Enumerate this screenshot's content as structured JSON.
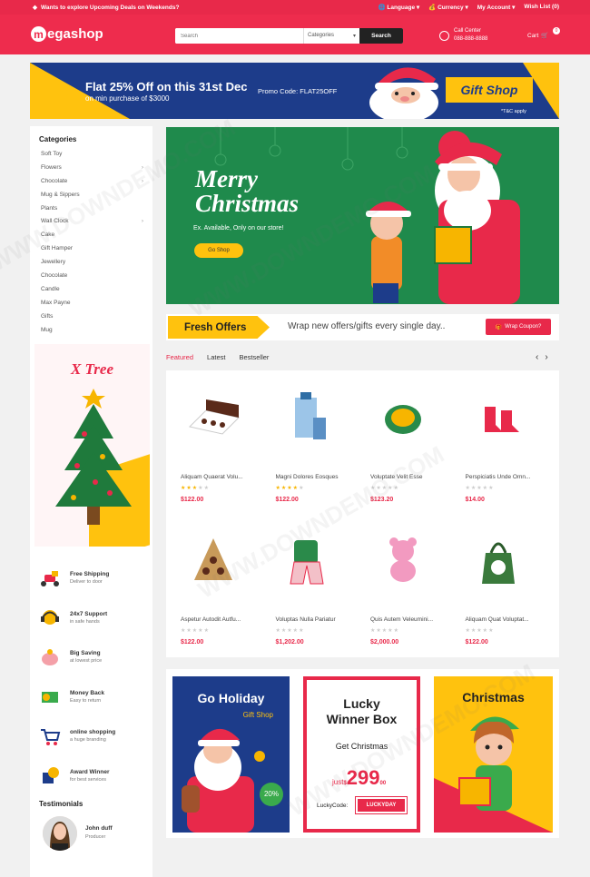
{
  "topbar": {
    "promo": "Wants to explore Upcoming Deals on Weekends?",
    "language": "Language",
    "currency": "Currency",
    "account": "My Account",
    "wishlist": "Wish List (0)"
  },
  "header": {
    "logo": "egashop",
    "logo_initial": "m",
    "search_placeholder": "Search",
    "categories_label": "Categories",
    "search_button": "Search",
    "call_label": "Call Center",
    "call_number": "088-888-8888",
    "cart_label": "Cart",
    "cart_count": "0"
  },
  "banner": {
    "title": "Flat 25% Off on this 31st Dec",
    "subtitle": "on min purchase of $3000",
    "promo_code": "Promo Code: FLAT25OFF",
    "gift_shop": "Gift Shop",
    "terms": "*T&C apply"
  },
  "categories": {
    "heading": "Categories",
    "items": [
      "Soft Toy",
      "Flowers",
      "Chocolate",
      "Mug & Sippers",
      "Plants",
      "Wall Clock",
      "Cake",
      "Gift Hamper",
      "Jewellery",
      "Chocolate",
      "Candle",
      "Max Payne",
      "Gifts",
      "Mug"
    ],
    "arrows": [
      false,
      true,
      true,
      false,
      false,
      true,
      false,
      false,
      false,
      false,
      false,
      false,
      false,
      false
    ]
  },
  "xtree": {
    "title": "X Tree"
  },
  "services": [
    {
      "title": "Free Shipping",
      "sub": "Deliver to door",
      "icon": "scooter-icon"
    },
    {
      "title": "24x7 Support",
      "sub": "in safe hands",
      "icon": "headset-icon"
    },
    {
      "title": "Big Saving",
      "sub": "at lowest price",
      "icon": "piggy-bank-icon"
    },
    {
      "title": "Money Back",
      "sub": "Easy to return",
      "icon": "money-icon"
    },
    {
      "title": "online shopping",
      "sub": "a huge branding",
      "icon": "cart-icon"
    },
    {
      "title": "Award Winner",
      "sub": "for best services",
      "icon": "award-icon"
    }
  ],
  "testimonials": {
    "heading": "Testimonials",
    "name": "John duff",
    "role": "Producer"
  },
  "hero": {
    "title_line1": "Merry",
    "title_line2": "Christmas",
    "subtitle": "Ex. Available, Only on our store!",
    "button": "Go Shop"
  },
  "fresh": {
    "tag": "Fresh Offers",
    "message": "Wrap new offers/gifts every single day..",
    "button": "Wrap Coupon?"
  },
  "tabs": [
    "Featured",
    "Latest",
    "Bestseller"
  ],
  "products": [
    {
      "name": "Aliquam Quaerat Volu...",
      "price": "$122.00",
      "rating": 3
    },
    {
      "name": "Magni Dolores Eosques",
      "price": "$122.00",
      "rating": 4
    },
    {
      "name": "Voluptate Velit Esse",
      "price": "$123.20",
      "rating": 0
    },
    {
      "name": "Perspiciatis Unde Omn...",
      "price": "$14.00",
      "rating": 0
    },
    {
      "name": "Aspetur Autodit Autfu...",
      "price": "$122.00",
      "rating": 0
    },
    {
      "name": "Voluptas Nulla Pariatur",
      "price": "$1,202.00",
      "rating": 0
    },
    {
      "name": "Quis Autem Veleumini...",
      "price": "$2,000.00",
      "rating": 0
    },
    {
      "name": "Aliquam Quat Voluptat...",
      "price": "$122.00",
      "rating": 0
    }
  ],
  "promo1": {
    "title": "Go Holiday",
    "sub": "Gift Shop",
    "badge": "20%"
  },
  "promo2": {
    "title_line1": "Lucky",
    "title_line2": "Winner Box",
    "sub": "Get Christmas",
    "just": "just",
    "currency": "$",
    "price": "299",
    "cents": "00",
    "code_label": "LuckyCode:",
    "code": "LUCKYDAY"
  },
  "promo3": {
    "title": "Christmas"
  },
  "watermark": "WWW.DOWNDEMO.COM",
  "colors": {
    "brand": "#ee2c4d",
    "accent": "#ffc20e",
    "navy": "#1d3c8a",
    "green": "#1f8a4c"
  }
}
